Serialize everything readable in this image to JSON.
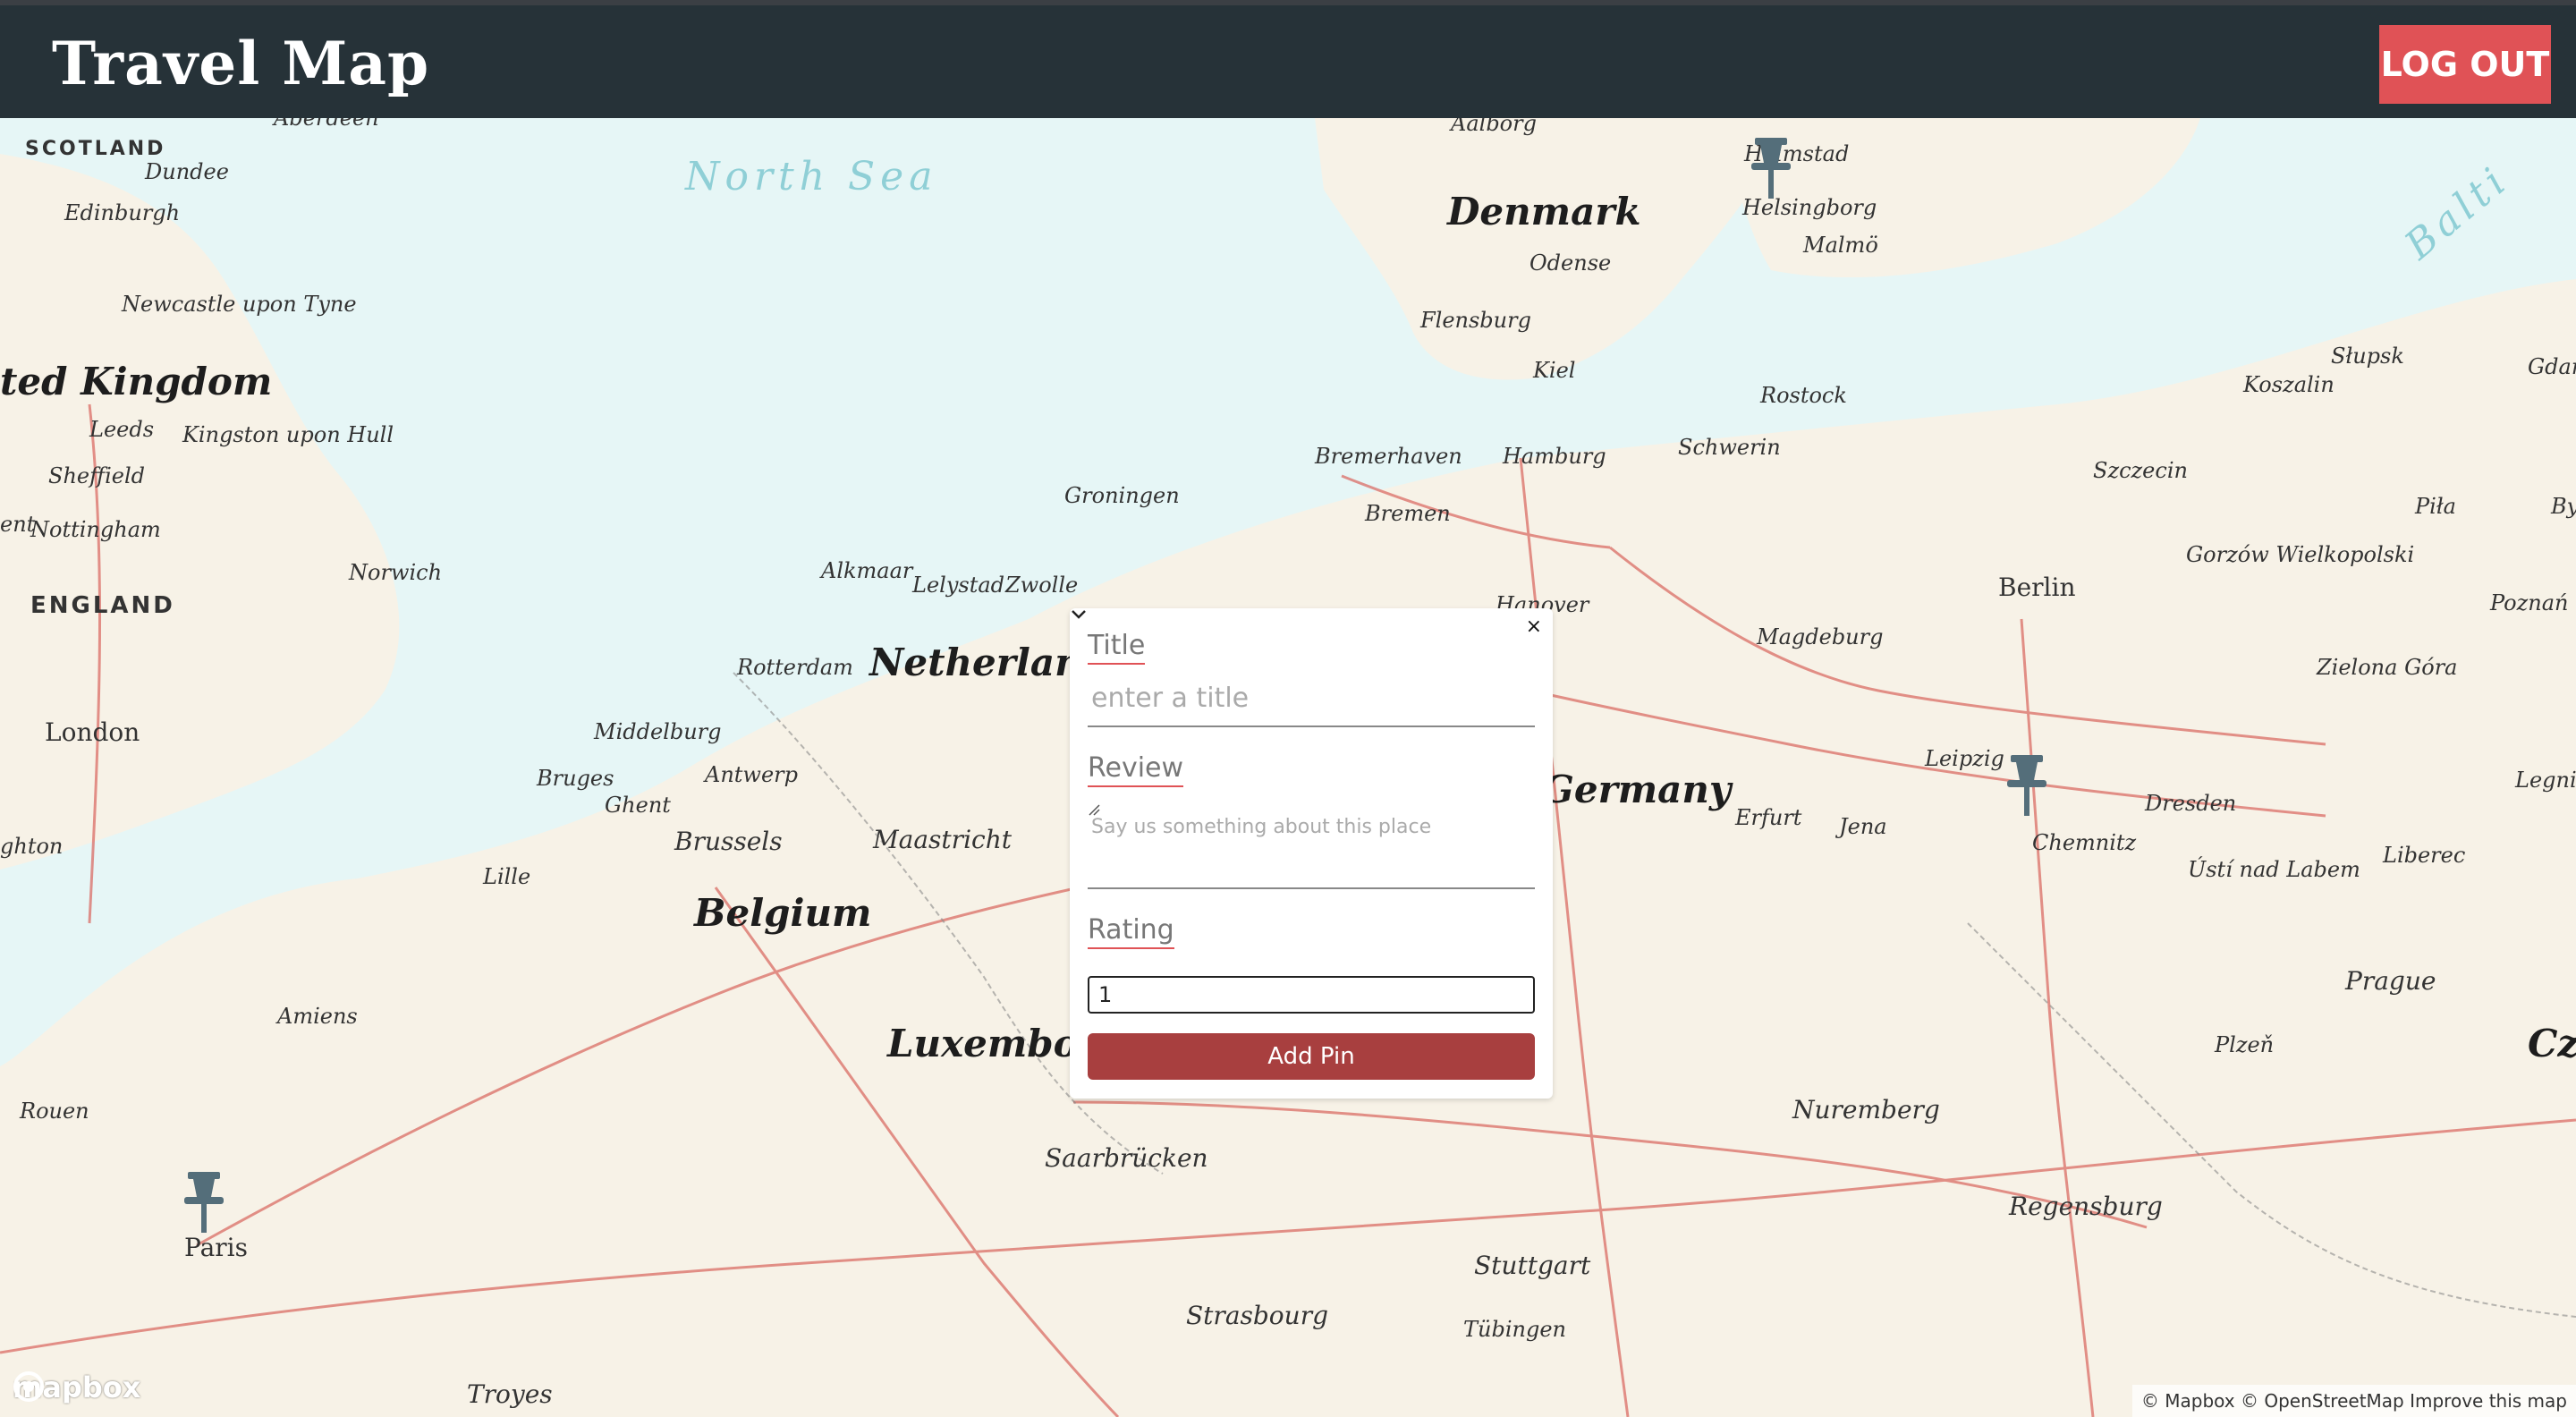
{
  "header": {
    "title": "Travel Map",
    "logout_label": "LOG OUT"
  },
  "map": {
    "seas": [
      "North Sea",
      "Balti"
    ],
    "countries": [
      "Denmark",
      "Netherlands",
      "Germany",
      "Belgium",
      "Luxembourg",
      "ted Kingdom",
      "Cze"
    ],
    "regions": [
      "SCOTLAND",
      "ENGLAND"
    ],
    "capitals": [
      "London",
      "Berlin",
      "Paris"
    ],
    "cities": [
      "Aberdeen",
      "Dundee",
      "Edinburgh",
      "Newcastle upon Tyne",
      "Leeds",
      "Kingston upon Hull",
      "Sheffield",
      "Nottingham",
      "Norwich",
      "ghton",
      "ent",
      "Aalborg",
      "Halmstad",
      "Helsingborg",
      "Malmö",
      "Odense",
      "Flensburg",
      "Kiel",
      "Rostock",
      "Słupsk",
      "Koszalin",
      "Gdańs",
      "Bremerhaven",
      "Hamburg",
      "Schwerin",
      "Szczecin",
      "Bremen",
      "Groningen",
      "Piła",
      "Gorzów Wielkopolski",
      "Alkmaar",
      "Lelystad",
      "Zwolle",
      "Hanover",
      "Magdeburg",
      "Poznań",
      "Rotterdam",
      "Zielona Góra",
      "Middelburg",
      "Antwerp",
      "Leipzig",
      "Bruges",
      "Ghent",
      "Erfurt",
      "Jena",
      "Dresden",
      "Legnica",
      "Brussels",
      "Maastricht",
      "Chemnitz",
      "Liberec",
      "Lille",
      "Ústí nad Labem",
      "Amiens",
      "Prague",
      "Plzeň",
      "Rouen",
      "Nuremberg",
      "Saarbrücken",
      "Regensburg",
      "Stuttgart",
      "Strasbourg",
      "Tübingen",
      "Troyes",
      "By"
    ],
    "attribution": "© Mapbox © OpenStreetMap  Improve this map",
    "logo": "mapbox"
  },
  "popup": {
    "close": "×",
    "title_label": "Title",
    "title_placeholder": "enter a title",
    "review_label": "Review",
    "review_placeholder": "Say us something about this place",
    "rating_label": "Rating",
    "rating_value": "1",
    "submit_label": "Add Pin"
  },
  "colors": {
    "header": "#263238",
    "logout": "#e05256",
    "add_pin": "#a83f3f",
    "water": "#e6f6f6",
    "land": "#f7f2e7",
    "pin": "#546e7a"
  },
  "pins": [
    "pin-icon",
    "pin-icon",
    "pin-icon"
  ]
}
